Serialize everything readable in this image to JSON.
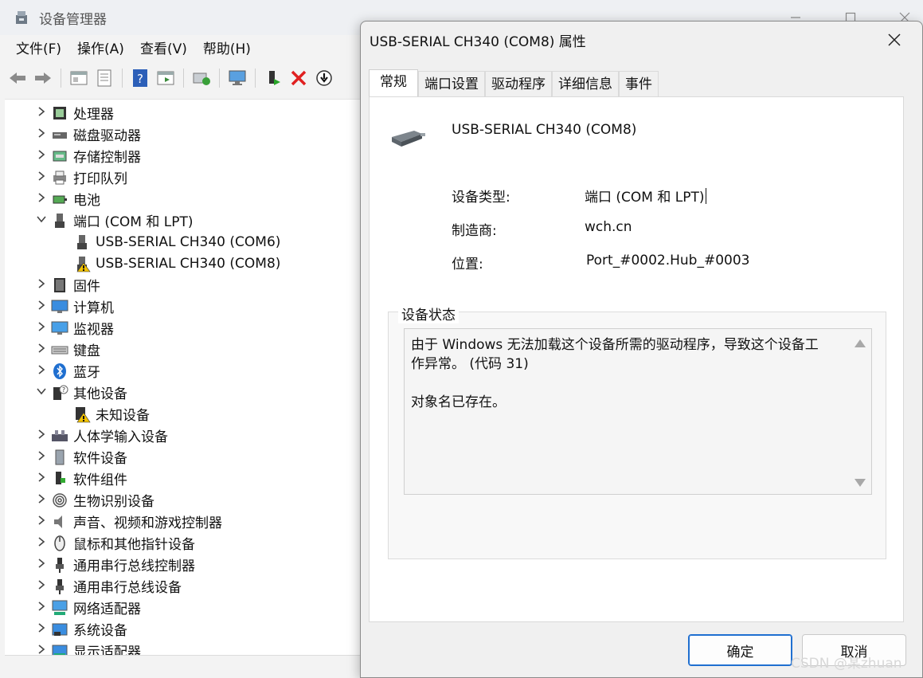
{
  "main_window": {
    "title": "设备管理器",
    "menu": [
      "文件(F)",
      "操作(A)",
      "查看(V)",
      "帮助(H)"
    ],
    "toolbar_icons": [
      "back-icon",
      "forward-icon",
      "properties-view-icon",
      "device-list-icon",
      "help-icon",
      "show-hidden-icon",
      "scan-hardware-icon",
      "monitor-icon",
      "enable-device-icon",
      "uninstall-icon",
      "update-driver-icon"
    ],
    "tree": [
      {
        "label": "处理器",
        "icon": "processor-icon",
        "level": 0,
        "expanded": false
      },
      {
        "label": "磁盘驱动器",
        "icon": "disk-drive-icon",
        "level": 0,
        "expanded": false
      },
      {
        "label": "存储控制器",
        "icon": "storage-controller-icon",
        "level": 0,
        "expanded": false
      },
      {
        "label": "打印队列",
        "icon": "printer-icon",
        "level": 0,
        "expanded": false
      },
      {
        "label": "电池",
        "icon": "battery-icon",
        "level": 0,
        "expanded": false
      },
      {
        "label": "端口 (COM 和 LPT)",
        "icon": "port-icon",
        "level": 0,
        "expanded": true
      },
      {
        "label": "USB-SERIAL CH340 (COM6)",
        "icon": "port-icon",
        "level": 1
      },
      {
        "label": "USB-SERIAL CH340 (COM8)",
        "icon": "port-warning-icon",
        "level": 1
      },
      {
        "label": "固件",
        "icon": "firmware-icon",
        "level": 0,
        "expanded": false
      },
      {
        "label": "计算机",
        "icon": "computer-icon",
        "level": 0,
        "expanded": false
      },
      {
        "label": "监视器",
        "icon": "monitor-icon",
        "level": 0,
        "expanded": false
      },
      {
        "label": "键盘",
        "icon": "keyboard-icon",
        "level": 0,
        "expanded": false
      },
      {
        "label": "蓝牙",
        "icon": "bluetooth-icon",
        "level": 0,
        "expanded": false
      },
      {
        "label": "其他设备",
        "icon": "unknown-device-icon",
        "level": 0,
        "expanded": true
      },
      {
        "label": "未知设备",
        "icon": "unknown-device-warning-icon",
        "level": 1
      },
      {
        "label": "人体学输入设备",
        "icon": "hid-icon",
        "level": 0,
        "expanded": false
      },
      {
        "label": "软件设备",
        "icon": "software-device-icon",
        "level": 0,
        "expanded": false
      },
      {
        "label": "软件组件",
        "icon": "software-component-icon",
        "level": 0,
        "expanded": false
      },
      {
        "label": "生物识别设备",
        "icon": "fingerprint-icon",
        "level": 0,
        "expanded": false
      },
      {
        "label": "声音、视频和游戏控制器",
        "icon": "speaker-icon",
        "level": 0,
        "expanded": false
      },
      {
        "label": "鼠标和其他指针设备",
        "icon": "mouse-icon",
        "level": 0,
        "expanded": false
      },
      {
        "label": "通用串行总线控制器",
        "icon": "usb-icon",
        "level": 0,
        "expanded": false
      },
      {
        "label": "通用串行总线设备",
        "icon": "usb-icon",
        "level": 0,
        "expanded": false
      },
      {
        "label": "网络适配器",
        "icon": "network-icon",
        "level": 0,
        "expanded": false
      },
      {
        "label": "系统设备",
        "icon": "system-device-icon",
        "level": 0,
        "expanded": false
      },
      {
        "label": "显示适配器",
        "icon": "display-adapter-icon",
        "level": 0,
        "expanded": false
      }
    ]
  },
  "dialog": {
    "title": "USB-SERIAL CH340 (COM8) 属性",
    "tabs": [
      "常规",
      "端口设置",
      "驱动程序",
      "详细信息",
      "事件"
    ],
    "active_tab": "常规",
    "device_name": "USB-SERIAL CH340 (COM8)",
    "properties": [
      {
        "label": "设备类型:",
        "value": "端口 (COM 和 LPT)"
      },
      {
        "label": "制造商:",
        "value": "wch.cn"
      },
      {
        "label": "位置:",
        "value": "Port_#0002.Hub_#0003"
      }
    ],
    "status_group_label": "设备状态",
    "status_lines": [
      "由于 Windows 无法加载这个设备所需的驱动程序，导致这个设备工",
      "作异常。 (代码 31)",
      "",
      "对象名已存在。"
    ],
    "ok_label": "确定",
    "cancel_label": "取消"
  },
  "watermark": "CSDN @某zhuan",
  "colors": {
    "accent": "#1f6fd0",
    "warning": "#f2c200",
    "error": "#e02020"
  }
}
